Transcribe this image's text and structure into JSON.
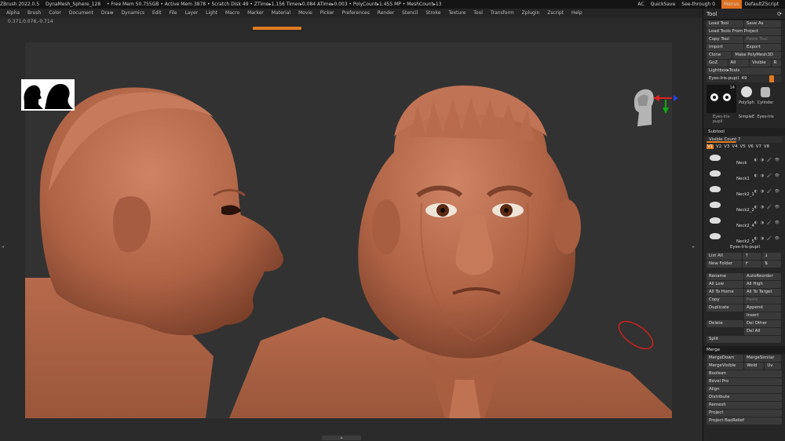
{
  "titlebar": {
    "items": [
      "ZBrush 2022.0.5",
      "DynaMesh_Sphere_128",
      "• Free Mem 50.755GB • Active Mem 3878 • Scratch Disk 49 • ZTime▸1.156 Timer▸0.084 ATime▸0.003 • PolyCount▸1.455 MP • MeshCount▸13"
    ],
    "ac": "AC",
    "quicksave": "QuickSave",
    "see_through": "See-through  0",
    "menus": "Menus",
    "script": "DefaultZScript"
  },
  "menubar": [
    "Alpha",
    "Brush",
    "Color",
    "Document",
    "Draw",
    "Dynamics",
    "Edit",
    "File",
    "Layer",
    "Light",
    "Macro",
    "Marker",
    "Material",
    "Movie",
    "Picker",
    "Preferences",
    "Render",
    "Stencil",
    "Stroke",
    "Texture",
    "Tool",
    "Transform",
    "Zplugin",
    "Zscript",
    "Help"
  ],
  "coords": "0.371,0.076,-0.714",
  "panel": {
    "title": "Tool",
    "rows": [
      [
        "Load Tool",
        "Save As"
      ],
      [
        "Load Tools From Project"
      ],
      [
        "Copy Tool",
        "Paste Tool"
      ],
      [
        "Import",
        "Export"
      ],
      [
        "Clone",
        "Make PolyMesh3D"
      ],
      [
        "GoZ",
        "All",
        "Visible",
        "R"
      ],
      [
        "Lightbox▸Tools"
      ]
    ],
    "current_tool": "Eyes-Iris-pupil. 49",
    "thumb_labels": [
      "PolySph",
      "Cylinder",
      "SimpleE",
      "Eyes-Iris"
    ],
    "thumb_caption": "Eyes-Iris-pupil",
    "thumb_count": "14",
    "subtool_title": "Subtool",
    "visible_count": "Visible Count 7",
    "vtabs": [
      "V1",
      "V2",
      "V3",
      "V4",
      "V5",
      "V6",
      "V7",
      "V8"
    ],
    "subtools": [
      "Neck",
      "Neck1",
      "Neck2_1",
      "Neck2_2",
      "Neck2_4",
      "Neck2_5",
      "Eyes-Iris-pupil"
    ],
    "list_rows": [
      [
        "List All",
        "↑",
        "↓"
      ],
      [
        "New Folder",
        "↱",
        "⇅"
      ],
      [
        "Rename",
        "AutoReorder"
      ],
      [
        "All Low",
        "All High"
      ],
      [
        "All To Home",
        "All To Target"
      ],
      [
        "Copy",
        "Paste"
      ],
      [
        "Duplicate",
        "Append"
      ],
      [
        "",
        "Insert"
      ],
      [
        "Delete",
        "Del Other"
      ],
      [
        "",
        "Del All"
      ],
      [
        "Split"
      ]
    ],
    "merge_title": "Merge",
    "merge_rows": [
      [
        "MergeDown",
        "MergeSimilar"
      ],
      [
        "MergeVisible",
        "Weld",
        "Uv"
      ]
    ],
    "extra_items": [
      "Boolean",
      "Bevel Pro",
      "Align",
      "Distribute",
      "Remesh",
      "Project",
      "Project BasRelief"
    ]
  },
  "colors": {
    "accent": "#e07a20",
    "clay": "#b76a4c",
    "background": "#323232"
  }
}
